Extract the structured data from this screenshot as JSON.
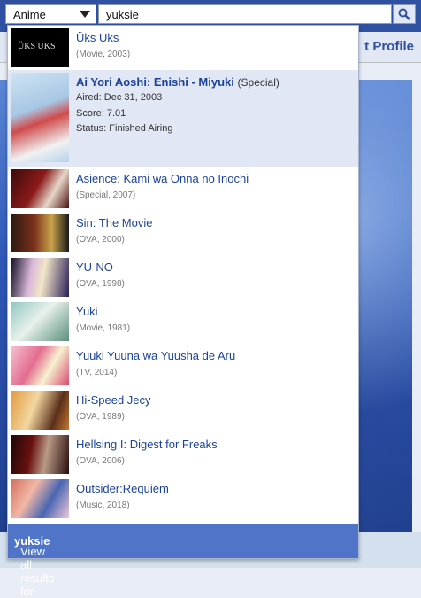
{
  "search": {
    "category": "Anime",
    "query": "yuksie",
    "view_all_prefix": "View all results for ",
    "view_all_query": "yuksie"
  },
  "background": {
    "nav_label": "t Profile"
  },
  "results": [
    {
      "title": "Üks Uks",
      "meta": "(Movie, 2003)",
      "thumb_text": "ÜKS UKS"
    },
    {
      "title": "Ai Yori Aoshi: Enishi - Miyuki",
      "type": "(Special)",
      "aired": "Aired: Dec 31, 2003",
      "score": "Score: 7.01",
      "status": "Status: Finished Airing"
    },
    {
      "title": "Asience: Kami wa Onna no Inochi",
      "meta": "(Special, 2007)"
    },
    {
      "title": "Sin: The Movie",
      "meta": "(OVA, 2000)"
    },
    {
      "title": "YU-NO",
      "meta": "(OVA, 1998)"
    },
    {
      "title": "Yuki",
      "meta": "(Movie, 1981)"
    },
    {
      "title": "Yuuki Yuuna wa Yuusha de Aru",
      "meta": "(TV, 2014)"
    },
    {
      "title": "Hi-Speed Jecy",
      "meta": "(OVA, 1989)"
    },
    {
      "title": "Hellsing I: Digest for Freaks",
      "meta": "(OVA, 2006)"
    },
    {
      "title": "Outsider:Requiem",
      "meta": "(Music, 2018)"
    }
  ],
  "colors": {
    "brand": "#2e51a2",
    "link": "#1c439b",
    "footer": "#4f74c8",
    "highlight": "#e1e7f5"
  },
  "icons": {
    "search_button": "search-icon",
    "select": "chevron-down-icon"
  }
}
